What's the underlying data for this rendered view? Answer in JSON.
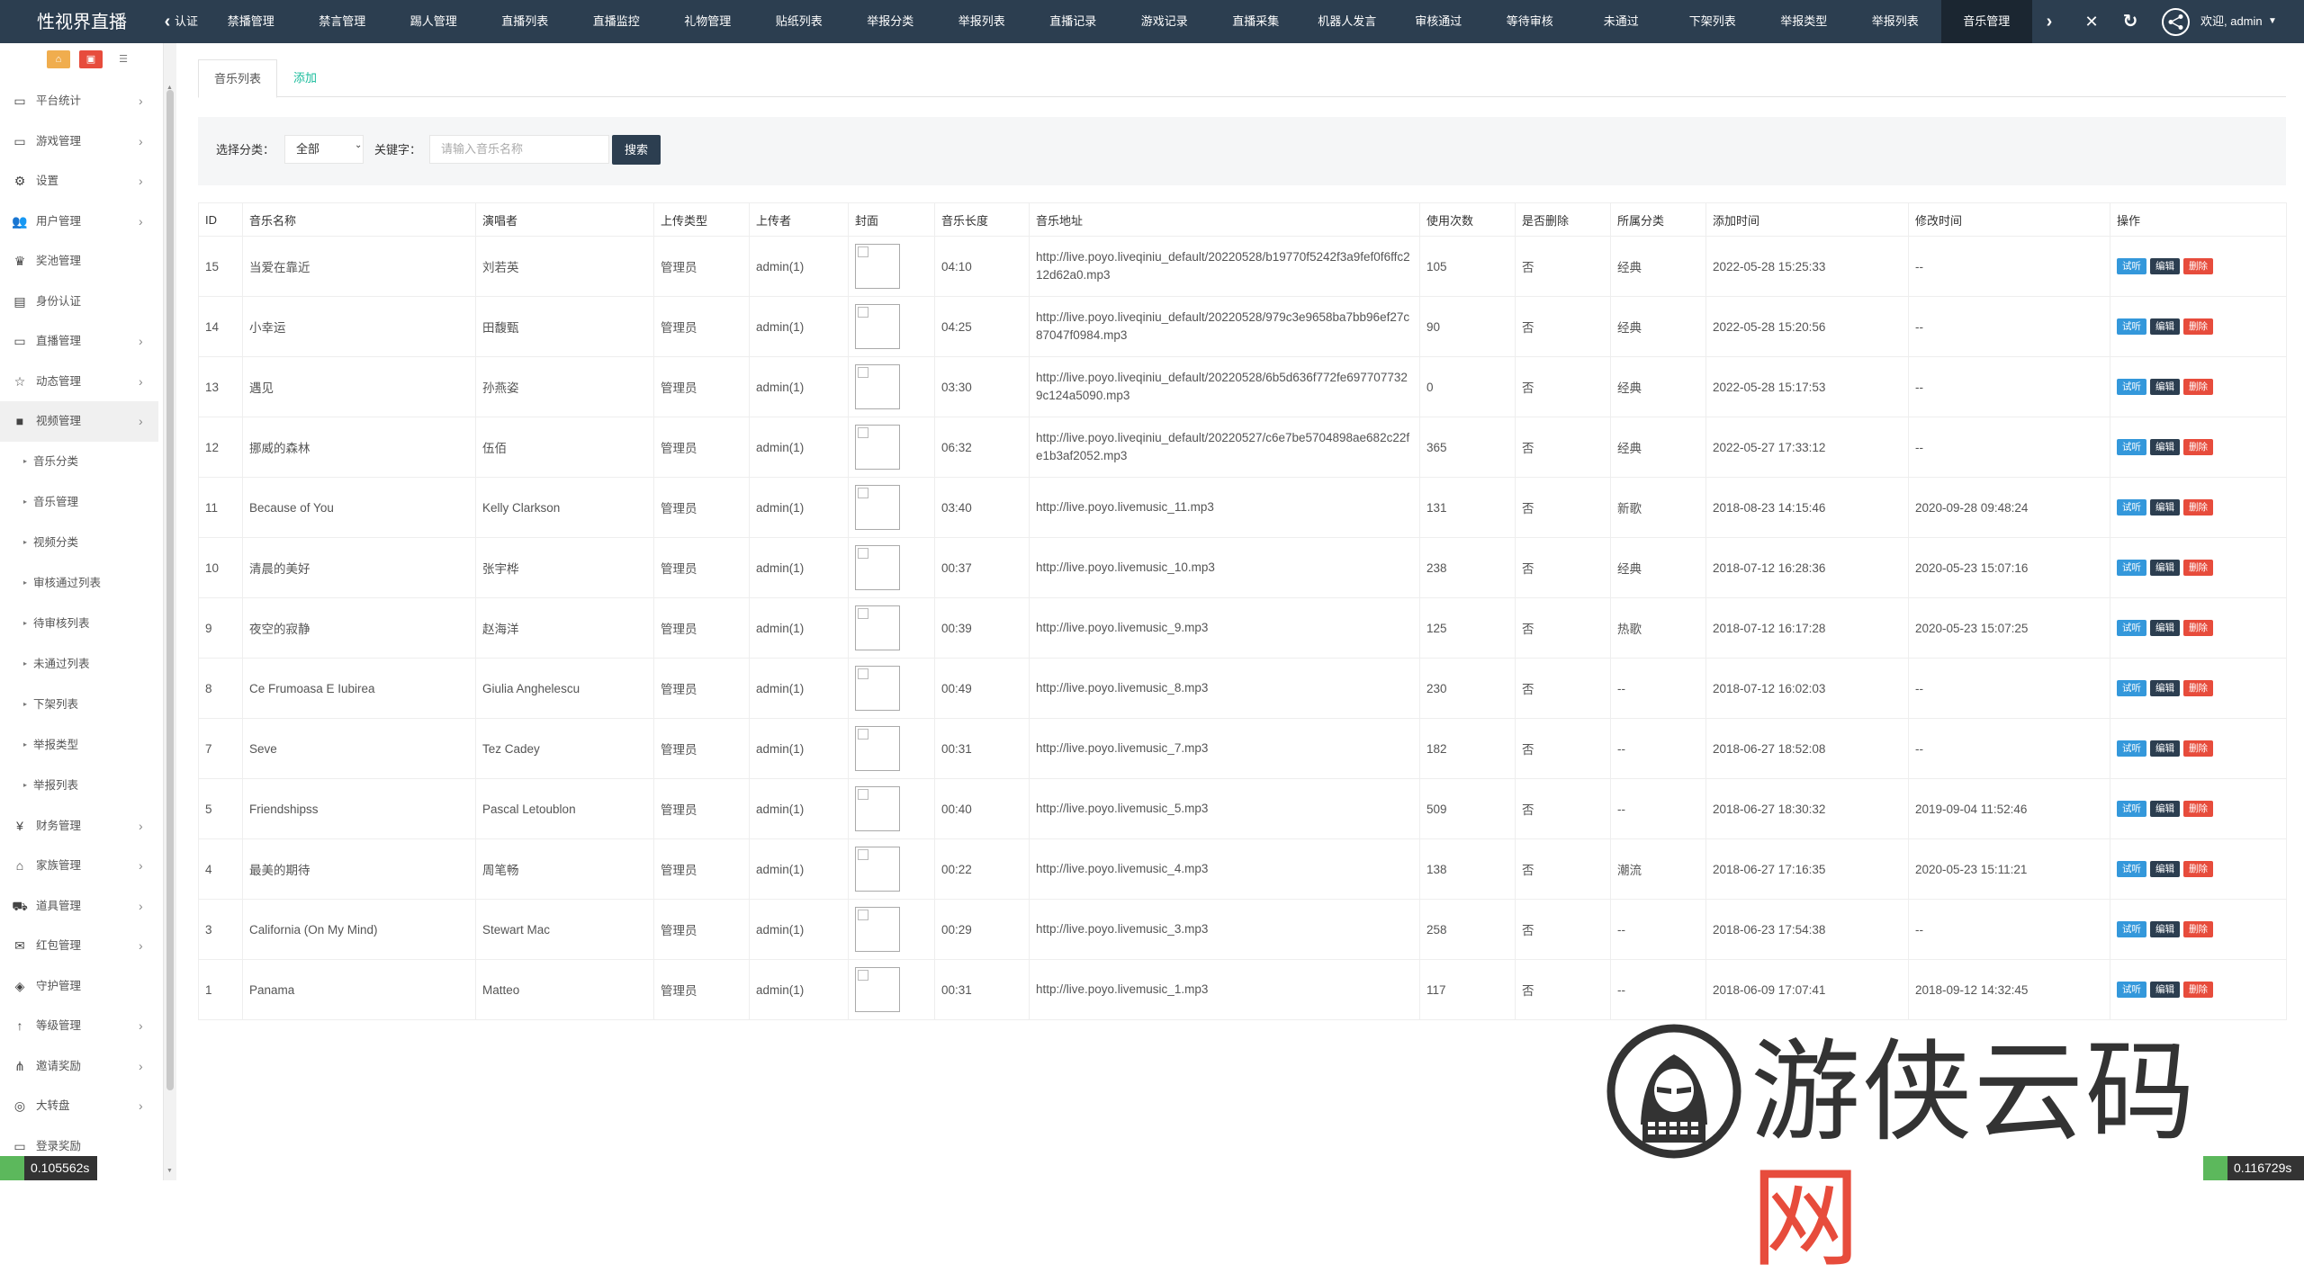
{
  "header": {
    "brand": "性视界直播",
    "tabs": [
      "认证",
      "禁播管理",
      "禁言管理",
      "踢人管理",
      "直播列表",
      "直播监控",
      "礼物管理",
      "贴纸列表",
      "举报分类",
      "举报列表",
      "直播记录",
      "游戏记录",
      "直播采集",
      "机器人发言",
      "审核通过",
      "等待审核",
      "未通过",
      "下架列表",
      "举报类型",
      "举报列表",
      "音乐管理"
    ],
    "active_tab": "音乐管理",
    "welcome": "欢迎, admin"
  },
  "sidebar": {
    "menu": [
      {
        "label": "平台统计",
        "icon": "monitor-icon",
        "has_arrow": true
      },
      {
        "label": "游戏管理",
        "icon": "monitor-icon",
        "has_arrow": true
      },
      {
        "label": "设置",
        "icon": "gears-icon",
        "has_arrow": true
      },
      {
        "label": "用户管理",
        "icon": "users-icon",
        "has_arrow": true
      },
      {
        "label": "奖池管理",
        "icon": "trophy-icon",
        "has_arrow": false
      },
      {
        "label": "身份认证",
        "icon": "id-card-icon",
        "has_arrow": false
      },
      {
        "label": "直播管理",
        "icon": "monitor-icon",
        "has_arrow": true
      },
      {
        "label": "动态管理",
        "icon": "star-icon",
        "has_arrow": true
      },
      {
        "label": "视频管理",
        "icon": "video-camera-icon",
        "has_arrow": true,
        "active": true
      }
    ],
    "submenu": [
      "音乐分类",
      "音乐管理",
      "视频分类",
      "审核通过列表",
      "待审核列表",
      "未通过列表",
      "下架列表",
      "举报类型",
      "举报列表"
    ],
    "menu_after": [
      {
        "label": "财务管理",
        "icon": "yen-icon",
        "has_arrow": true
      },
      {
        "label": "家族管理",
        "icon": "bank-icon",
        "has_arrow": true
      },
      {
        "label": "道具管理",
        "icon": "cart-icon",
        "has_arrow": true
      },
      {
        "label": "红包管理",
        "icon": "envelope-icon",
        "has_arrow": true
      },
      {
        "label": "守护管理",
        "icon": "shield-icon",
        "has_arrow": false
      },
      {
        "label": "等级管理",
        "icon": "level-up-icon",
        "has_arrow": true
      },
      {
        "label": "邀请奖励",
        "icon": "sitemap-icon",
        "has_arrow": true
      },
      {
        "label": "大转盘",
        "icon": "gamepad-icon",
        "has_arrow": true
      },
      {
        "label": "登录奖励",
        "icon": "monitor-icon",
        "has_arrow": false
      }
    ]
  },
  "subtabs": {
    "list": "音乐列表",
    "add": "添加"
  },
  "filter": {
    "category_label": "选择分类：",
    "category_value": "全部",
    "keyword_label": "关键字：",
    "keyword_placeholder": "请输入音乐名称",
    "search_button": "搜索"
  },
  "table": {
    "headers": [
      "ID",
      "音乐名称",
      "演唱者",
      "上传类型",
      "上传者",
      "封面",
      "音乐长度",
      "音乐地址",
      "使用次数",
      "是否删除",
      "所属分类",
      "添加时间",
      "修改时间",
      "操作"
    ],
    "actions": {
      "listen": "试听",
      "edit": "编辑",
      "delete": "删除"
    },
    "rows": [
      {
        "id": "15",
        "name": "当爱在靠近",
        "singer": "刘若英",
        "upload_type": "管理员",
        "uploader": "admin(1)",
        "length": "04:10",
        "url": "http://live.poyo.liveqiniu_default/20220528/b19770f5242f3a9fef0f6ffc212d62a0.mp3",
        "uses": "105",
        "deleted": "否",
        "category": "经典",
        "added": "2022-05-28 15:25:33",
        "modified": "--"
      },
      {
        "id": "14",
        "name": "小幸运",
        "singer": "田馥甄",
        "upload_type": "管理员",
        "uploader": "admin(1)",
        "length": "04:25",
        "url": "http://live.poyo.liveqiniu_default/20220528/979c3e9658ba7bb96ef27c87047f0984.mp3",
        "uses": "90",
        "deleted": "否",
        "category": "经典",
        "added": "2022-05-28 15:20:56",
        "modified": "--"
      },
      {
        "id": "13",
        "name": "遇见",
        "singer": "孙燕姿",
        "upload_type": "管理员",
        "uploader": "admin(1)",
        "length": "03:30",
        "url": "http://live.poyo.liveqiniu_default/20220528/6b5d636f772fe6977077329c124a5090.mp3",
        "uses": "0",
        "deleted": "否",
        "category": "经典",
        "added": "2022-05-28 15:17:53",
        "modified": "--"
      },
      {
        "id": "12",
        "name": "挪威的森林",
        "singer": "伍佰",
        "upload_type": "管理员",
        "uploader": "admin(1)",
        "length": "06:32",
        "url": "http://live.poyo.liveqiniu_default/20220527/c6e7be5704898ae682c22fe1b3af2052.mp3",
        "uses": "365",
        "deleted": "否",
        "category": "经典",
        "added": "2022-05-27 17:33:12",
        "modified": "--"
      },
      {
        "id": "11",
        "name": "Because of You",
        "singer": "Kelly Clarkson",
        "upload_type": "管理员",
        "uploader": "admin(1)",
        "length": "03:40",
        "url": "http://live.poyo.livemusic_11.mp3",
        "uses": "131",
        "deleted": "否",
        "category": "新歌",
        "added": "2018-08-23 14:15:46",
        "modified": "2020-09-28 09:48:24"
      },
      {
        "id": "10",
        "name": "清晨的美好",
        "singer": "张宇桦",
        "upload_type": "管理员",
        "uploader": "admin(1)",
        "length": "00:37",
        "url": "http://live.poyo.livemusic_10.mp3",
        "uses": "238",
        "deleted": "否",
        "category": "经典",
        "added": "2018-07-12 16:28:36",
        "modified": "2020-05-23 15:07:16"
      },
      {
        "id": "9",
        "name": "夜空的寂静",
        "singer": "赵海洋",
        "upload_type": "管理员",
        "uploader": "admin(1)",
        "length": "00:39",
        "url": "http://live.poyo.livemusic_9.mp3",
        "uses": "125",
        "deleted": "否",
        "category": "热歌",
        "added": "2018-07-12 16:17:28",
        "modified": "2020-05-23 15:07:25"
      },
      {
        "id": "8",
        "name": "Ce Frumoasa E Iubirea",
        "singer": "Giulia Anghelescu",
        "upload_type": "管理员",
        "uploader": "admin(1)",
        "length": "00:49",
        "url": "http://live.poyo.livemusic_8.mp3",
        "uses": "230",
        "deleted": "否",
        "category": "--",
        "added": "2018-07-12 16:02:03",
        "modified": "--"
      },
      {
        "id": "7",
        "name": "Seve",
        "singer": "Tez Cadey",
        "upload_type": "管理员",
        "uploader": "admin(1)",
        "length": "00:31",
        "url": "http://live.poyo.livemusic_7.mp3",
        "uses": "182",
        "deleted": "否",
        "category": "--",
        "added": "2018-06-27 18:52:08",
        "modified": "--"
      },
      {
        "id": "5",
        "name": "Friendshipss",
        "singer": "Pascal Letoublon",
        "upload_type": "管理员",
        "uploader": "admin(1)",
        "length": "00:40",
        "url": "http://live.poyo.livemusic_5.mp3",
        "uses": "509",
        "deleted": "否",
        "category": "--",
        "added": "2018-06-27 18:30:32",
        "modified": "2019-09-04 11:52:46"
      },
      {
        "id": "4",
        "name": "最美的期待",
        "singer": "周笔畅",
        "upload_type": "管理员",
        "uploader": "admin(1)",
        "length": "00:22",
        "url": "http://live.poyo.livemusic_4.mp3",
        "uses": "138",
        "deleted": "否",
        "category": "潮流",
        "added": "2018-06-27 17:16:35",
        "modified": "2020-05-23 15:11:21"
      },
      {
        "id": "3",
        "name": "California (On My Mind)",
        "singer": "Stewart Mac",
        "upload_type": "管理员",
        "uploader": "admin(1)",
        "length": "00:29",
        "url": "http://live.poyo.livemusic_3.mp3",
        "uses": "258",
        "deleted": "否",
        "category": "--",
        "added": "2018-06-23 17:54:38",
        "modified": "--"
      },
      {
        "id": "1",
        "name": "Panama",
        "singer": "Matteo",
        "upload_type": "管理员",
        "uploader": "admin(1)",
        "length": "00:31",
        "url": "http://live.poyo.livemusic_1.mp3",
        "uses": "117",
        "deleted": "否",
        "category": "--",
        "added": "2018-06-09 17:07:41",
        "modified": "2018-09-12 14:32:45"
      }
    ]
  },
  "timers": {
    "left": "0.105562s",
    "right": "0.116729s"
  },
  "watermark": {
    "text_main": "游侠云码",
    "text_accent": "网"
  },
  "colors": {
    "topbar": "#2c3e50",
    "accent_green": "#1abc9c",
    "listen": "#3498db",
    "edit": "#2c3e50",
    "delete": "#e74c3c"
  }
}
